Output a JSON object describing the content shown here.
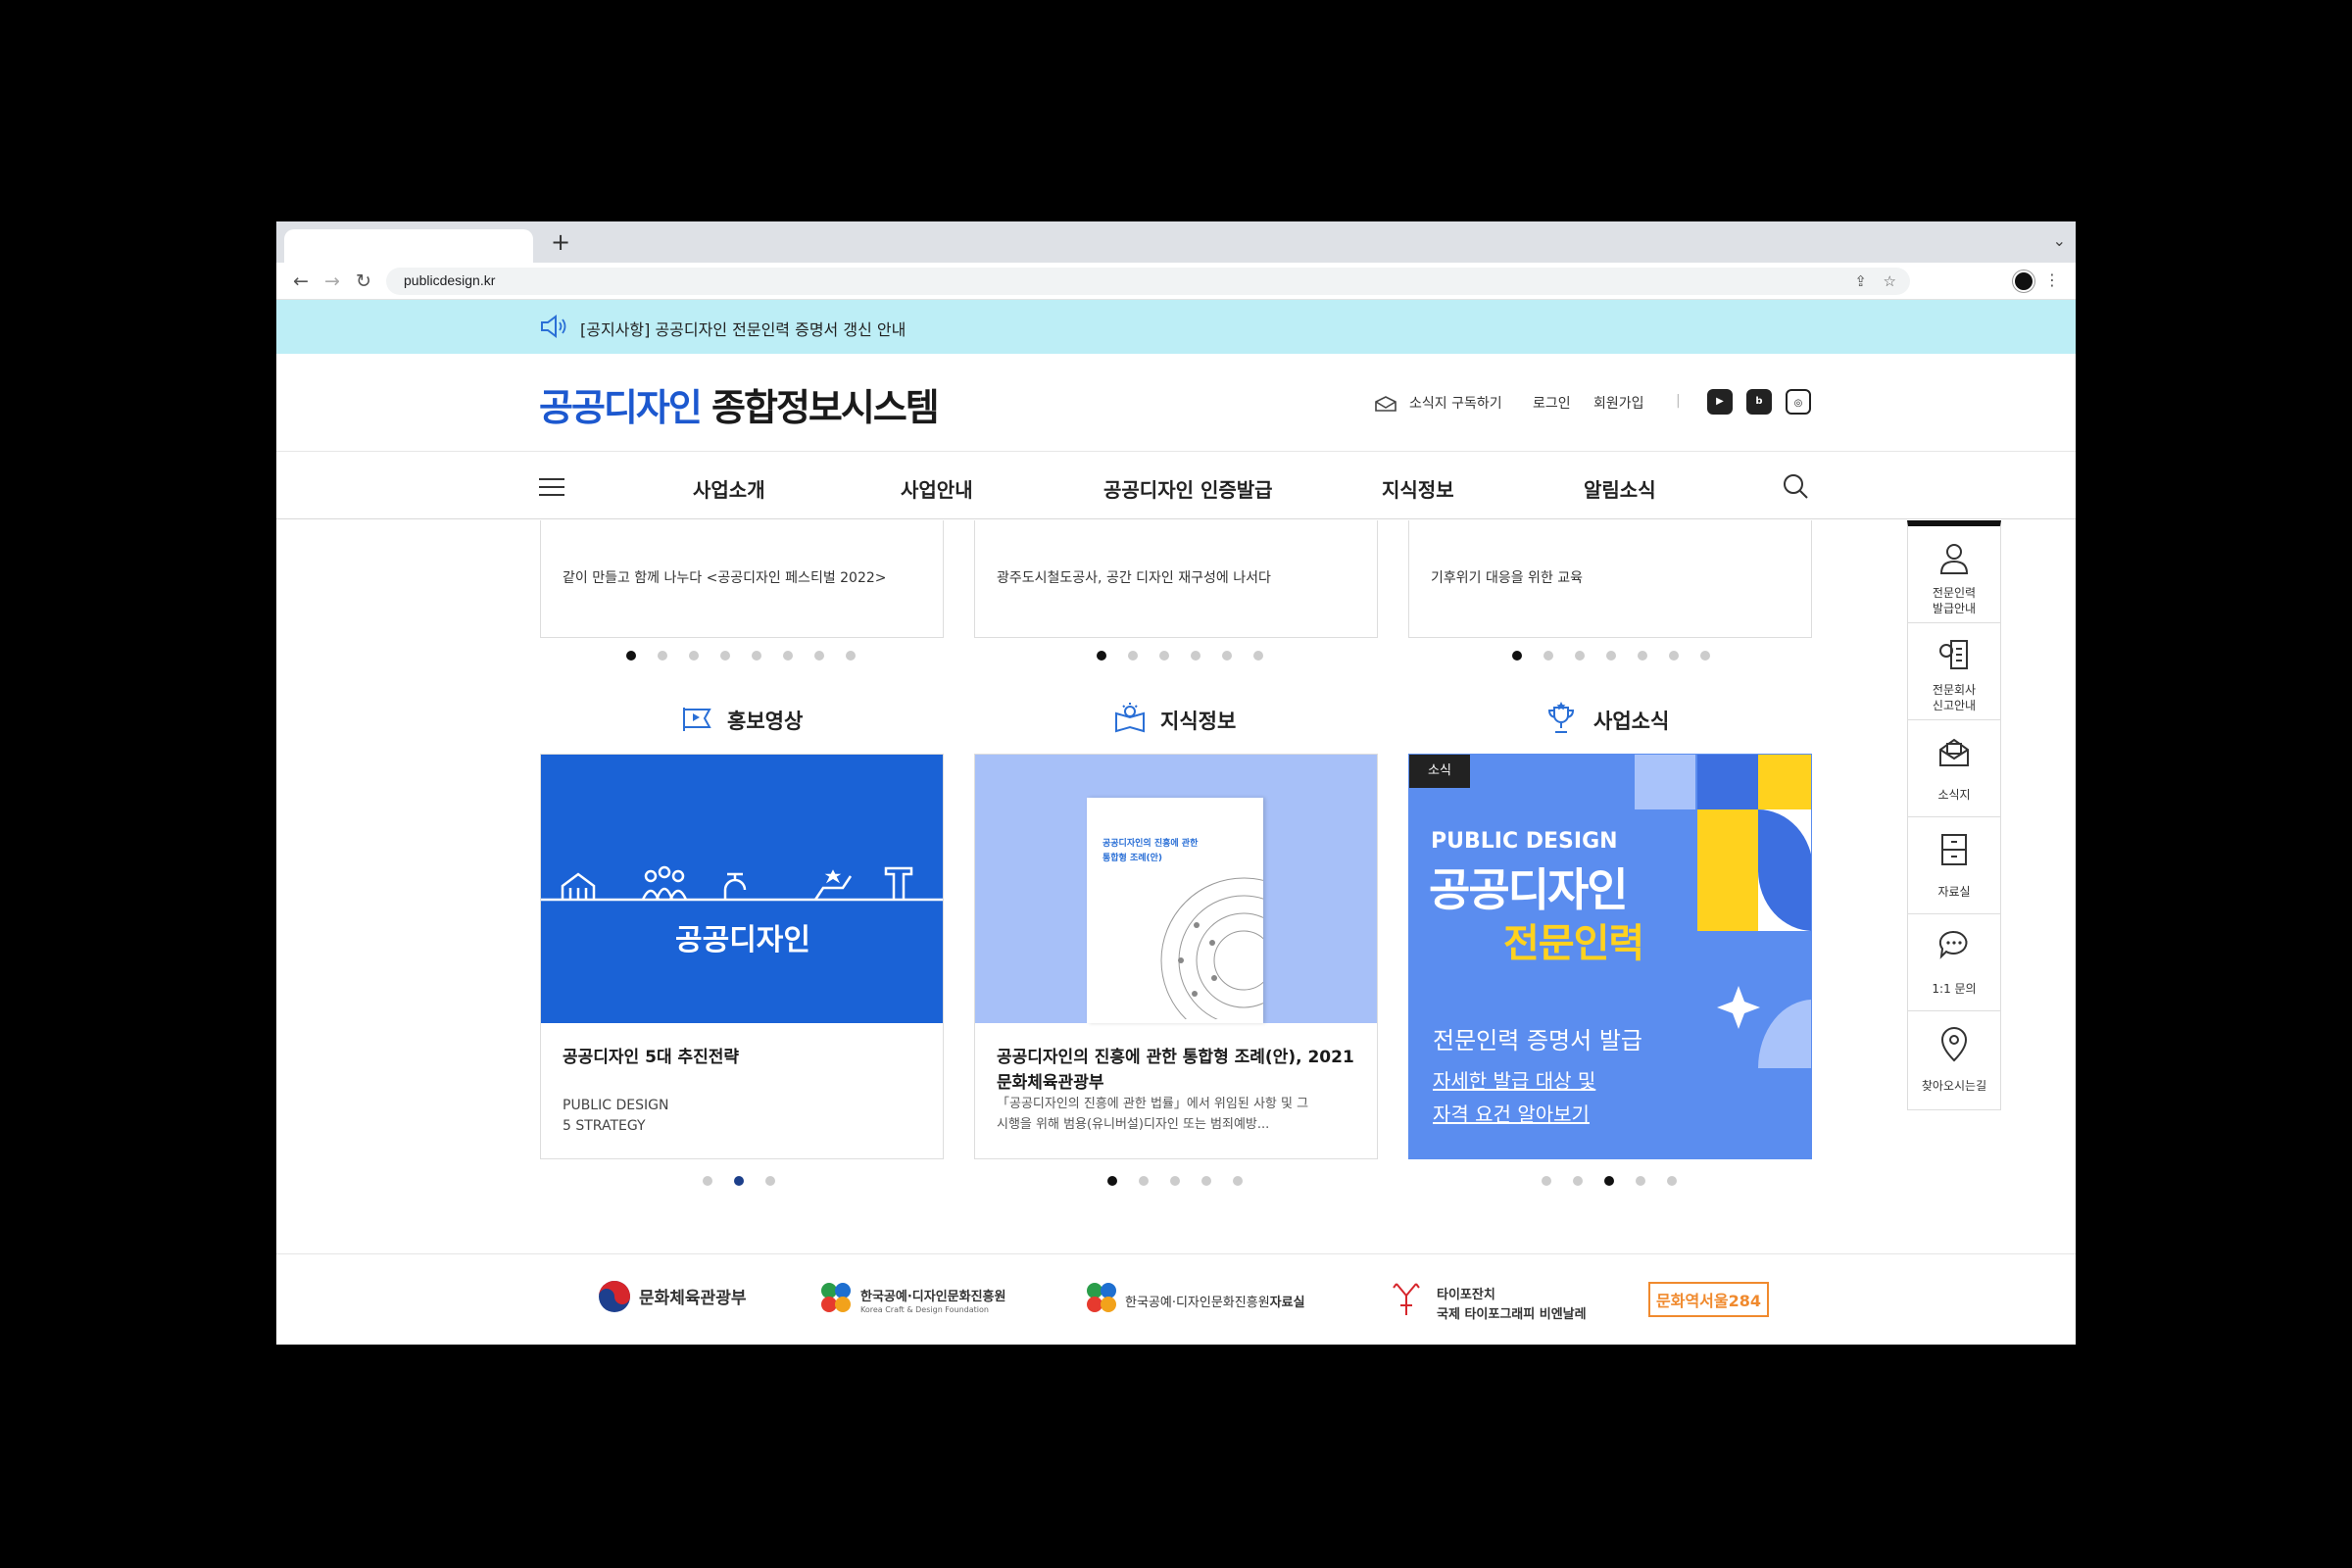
{
  "browser": {
    "url": "publicdesign.kr",
    "new_tab": "+"
  },
  "notice": {
    "text": "[공지사항] 공공디자인 전문인력 증명서 갱신 안내"
  },
  "header": {
    "logo_blue": "공공디자인",
    "logo_dark": " 종합정보시스템",
    "subscribe": "소식지 구독하기",
    "login": "로그인",
    "signup": "회원가입",
    "sns": [
      "youtube-icon",
      "blog-icon",
      "instagram-icon"
    ]
  },
  "gnb": {
    "items": [
      "사업소개",
      "사업안내",
      "공공디자인 인증발급",
      "지식정보",
      "알림소식"
    ]
  },
  "top_cards": [
    {
      "text": "같이 만들고 함께 나누다 <공공디자인 페스티벌 2022>",
      "dots": 8,
      "active": 0
    },
    {
      "text": "광주도시철도공사, 공간 디자인 재구성에 나서다",
      "dots": 6,
      "active": 0
    },
    {
      "text": "기후위기 대응을 위한 교육",
      "dots": 7,
      "active": 0
    }
  ],
  "sections": [
    {
      "title": "홍보영상",
      "card_title": "공공디자인 5대 추진전략",
      "card_sub1": "PUBLIC DESIGN",
      "card_sub2": "5 STRATEGY",
      "image_logo": "공공디자인",
      "dots": 3,
      "active": 1
    },
    {
      "title": "지식정보",
      "card_title1": "공공디자인의 진흥에 관한 통합형 조례(안), 2021",
      "card_title2": "문화체육관광부",
      "card_desc1": "「공공디자인의 진흥에 관한 법률」에서 위임된 사항 및 그",
      "card_desc2": "시행을 위해 범용(유니버설)디자인 또는 범죄예방...",
      "book_title1": "공공디자인의 진흥에 관한",
      "book_title2": "통합형 조례(안)",
      "dots": 5,
      "active": 0
    },
    {
      "title": "사업소식",
      "badge": "소식",
      "banner_en": "PUBLIC DESIGN",
      "banner_ko1": "공공디자인",
      "banner_ko2": "전문인력",
      "banner_caption": "전문인력 증명서 발급",
      "banner_link1": "자세한 발급 대상 및",
      "banner_link2": "자격 요건 알아보기",
      "dots": 5,
      "active": 2
    }
  ],
  "quick_menu": [
    {
      "icon": "person-icon",
      "label1": "전문인력",
      "label2": "발급안내"
    },
    {
      "icon": "company-icon",
      "label1": "전문회사",
      "label2": "신고안내"
    },
    {
      "icon": "newsletter-icon",
      "label1": "소식지",
      "label2": ""
    },
    {
      "icon": "archive-icon",
      "label1": "자료실",
      "label2": ""
    },
    {
      "icon": "chat-icon",
      "label1": "1:1 문의",
      "label2": ""
    },
    {
      "icon": "location-icon",
      "label1": "찾아오시는길",
      "label2": ""
    }
  ],
  "footer": {
    "mcst": "문화체육관광부",
    "kcdf": "한국공예·디자인문화진흥원",
    "kcdf_en": "Korea Craft & Design Foundation",
    "kcdf_lib_a": "한국공예·디자인문화진흥원",
    "kcdf_lib_b": "자료실",
    "typo1": "타이포잔치",
    "typo2": "국제 타이포그래피 비엔날레",
    "culture": "문화역서울284"
  },
  "colors": {
    "brand_blue": "#1c58cf",
    "notice_bg": "#bdeef6",
    "banner_blue": "#5b8def",
    "banner_yellow": "#ffd21e"
  }
}
